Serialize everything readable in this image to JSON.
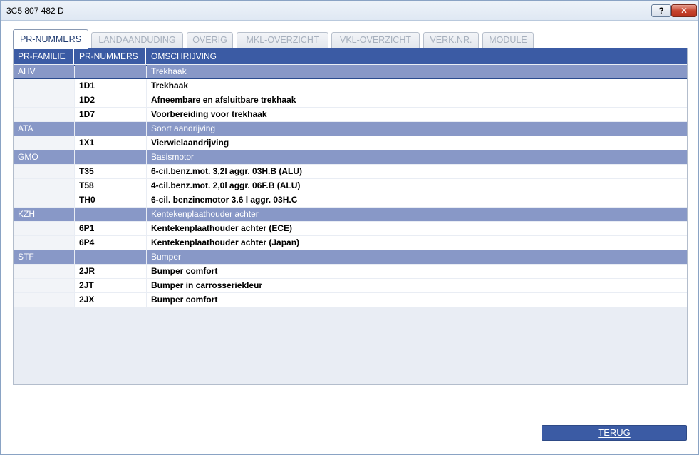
{
  "window": {
    "title": "3C5 807 482 D",
    "help_label": "?",
    "close_label": "✕"
  },
  "tabs": [
    {
      "label": "PR-NUMMERS",
      "active": true
    },
    {
      "label": "LANDAANDUDING",
      "active": false
    },
    {
      "label": "OVERIG",
      "active": false
    },
    {
      "label": "MKL-OVERZICHT",
      "active": false
    },
    {
      "label": "VKL-OVERZICHT",
      "active": false
    },
    {
      "label": "VERK.NR.",
      "active": false
    },
    {
      "label": "MODULE",
      "active": false
    }
  ],
  "grid": {
    "columns": [
      "PR-FAMILIE",
      "PR-NUMMERS",
      "OMSCHRIJVING"
    ],
    "rows": [
      {
        "type": "group",
        "familie": "AHV",
        "nummer": "",
        "omschrijving": "Trekhaak",
        "selected": true
      },
      {
        "type": "item",
        "familie": "",
        "nummer": "1D1",
        "omschrijving": "Trekhaak"
      },
      {
        "type": "item",
        "familie": "",
        "nummer": "1D2",
        "omschrijving": "Afneembare en afsluitbare trekhaak"
      },
      {
        "type": "item",
        "familie": "",
        "nummer": "1D7",
        "omschrijving": "Voorbereiding voor trekhaak"
      },
      {
        "type": "group",
        "familie": "ATA",
        "nummer": "",
        "omschrijving": "Soort aandrijving"
      },
      {
        "type": "item",
        "familie": "",
        "nummer": "1X1",
        "omschrijving": "Vierwielaandrijving"
      },
      {
        "type": "group",
        "familie": "GMO",
        "nummer": "",
        "omschrijving": "Basismotor"
      },
      {
        "type": "item",
        "familie": "",
        "nummer": "T35",
        "omschrijving": "6-cil.benz.mot. 3,2l aggr. 03H.B (ALU)"
      },
      {
        "type": "item",
        "familie": "",
        "nummer": "T58",
        "omschrijving": "4-cil.benz.mot. 2,0l aggr. 06F.B (ALU)"
      },
      {
        "type": "item",
        "familie": "",
        "nummer": "TH0",
        "omschrijving": "6-cil. benzinemotor 3.6 l aggr. 03H.C"
      },
      {
        "type": "group",
        "familie": "KZH",
        "nummer": "",
        "omschrijving": "Kentekenplaathouder achter"
      },
      {
        "type": "item",
        "familie": "",
        "nummer": "6P1",
        "omschrijving": "Kentekenplaathouder achter (ECE)"
      },
      {
        "type": "item",
        "familie": "",
        "nummer": "6P4",
        "omschrijving": "Kentekenplaathouder achter (Japan)"
      },
      {
        "type": "group",
        "familie": "STF",
        "nummer": "",
        "omschrijving": "Bumper"
      },
      {
        "type": "item",
        "familie": "",
        "nummer": "2JR",
        "omschrijving": "Bumper comfort"
      },
      {
        "type": "item",
        "familie": "",
        "nummer": "2JT",
        "omschrijving": "Bumper in carrosseriekleur"
      },
      {
        "type": "item",
        "familie": "",
        "nummer": "2JX",
        "omschrijving": "Bumper comfort"
      }
    ]
  },
  "footer": {
    "back_label": "TERUG"
  }
}
